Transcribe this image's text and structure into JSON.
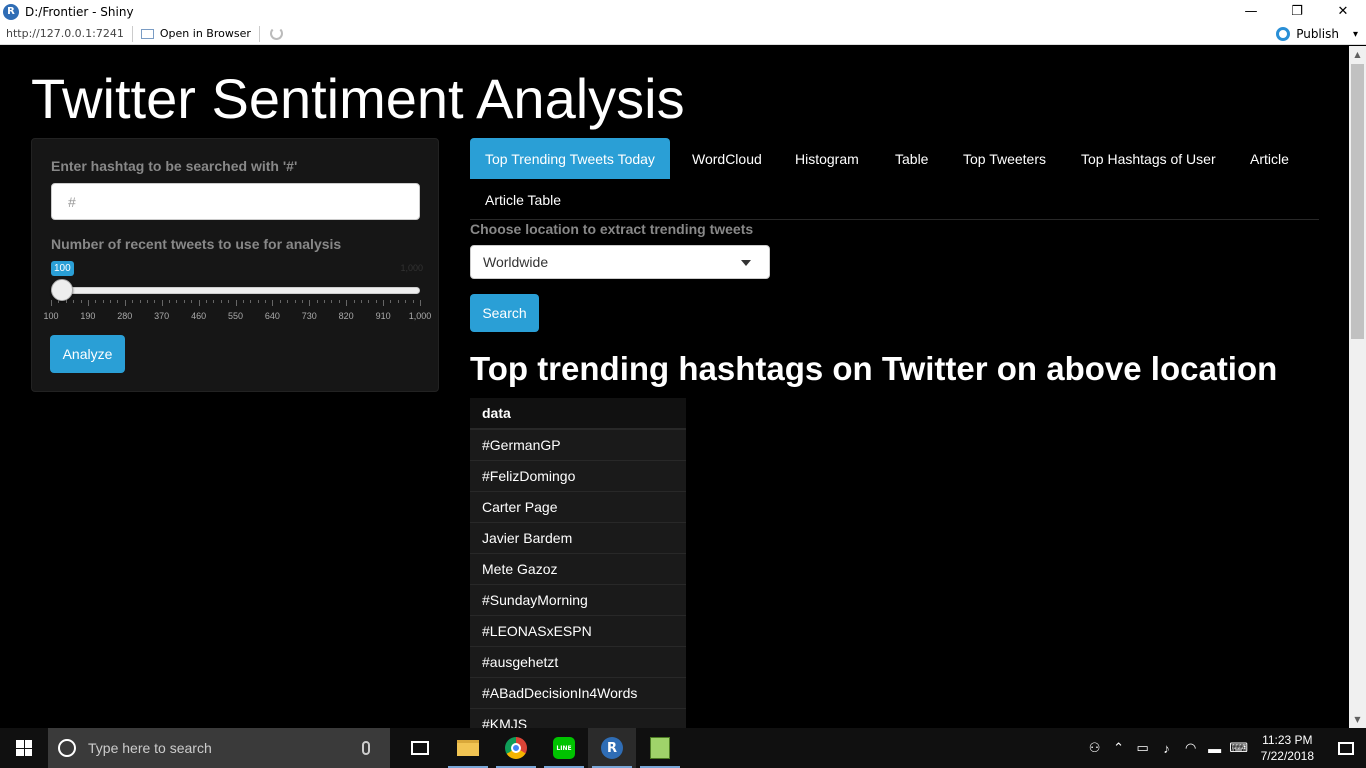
{
  "window": {
    "title": "D:/Frontier - Shiny",
    "app_icon": "R",
    "minimize": "—",
    "restore": "❐",
    "close": "✕"
  },
  "toolbar": {
    "url": "http://127.0.0.1:7241",
    "open_in_browser": "Open in Browser",
    "publish": "Publish",
    "publish_caret": "▾"
  },
  "app": {
    "title": "Twitter Sentiment Analysis",
    "sidebar": {
      "hashtag_label": "Enter hashtag to be searched with '#'",
      "hashtag_value": "#",
      "tweets_label": "Number of recent tweets to use for analysis",
      "slider": {
        "value": 100,
        "value_label": "100",
        "max_label": "1,000",
        "min": 100,
        "max": 1000,
        "ticks": [
          "100",
          "190",
          "280",
          "370",
          "460",
          "550",
          "640",
          "730",
          "820",
          "910",
          "1,000"
        ]
      },
      "analyze_label": "Analyze"
    },
    "tabs": [
      {
        "label": "Top Trending Tweets Today",
        "active": true
      },
      {
        "label": "WordCloud",
        "active": false
      },
      {
        "label": "Histogram",
        "active": false
      },
      {
        "label": "Table",
        "active": false
      },
      {
        "label": "Top Tweeters",
        "active": false
      },
      {
        "label": "Top Hashtags of User",
        "active": false
      },
      {
        "label": "Article",
        "active": false
      },
      {
        "label": "Article Table",
        "active": false
      }
    ],
    "location_label": "Choose location to extract trending tweets",
    "location_value": "Worldwide",
    "search_label": "Search",
    "section_title": "Top trending hashtags on Twitter on above location",
    "table": {
      "header": "data",
      "rows": [
        "#GermanGP",
        "#FelizDomingo",
        "Carter Page",
        "Javier Bardem",
        "Mete Gazoz",
        "#SundayMorning",
        "#LEONASxESPN",
        "#ausgehetzt",
        "#ABadDecisionIn4Words",
        "#KMJS"
      ]
    }
  },
  "taskbar": {
    "search_placeholder": "Type here to search",
    "line_label": "LINE",
    "r_label": "R",
    "time": "11:23 PM",
    "date": "7/22/2018"
  },
  "colors": {
    "accent": "#2a9fd6",
    "background": "#000000",
    "panel": "#161616"
  }
}
